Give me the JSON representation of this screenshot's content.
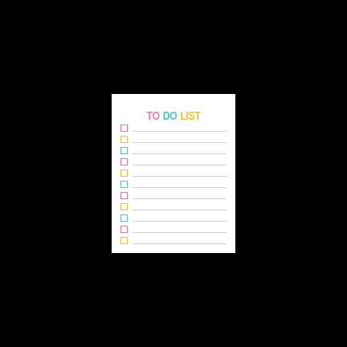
{
  "title": {
    "words": [
      {
        "text": "TO",
        "color": "#ec7ab8"
      },
      {
        "text": "DO",
        "color": "#4ec3c9"
      },
      {
        "text": "LIST",
        "color": "#f2c22a"
      }
    ]
  },
  "checklist": {
    "items": [
      {
        "checked": false,
        "color": "#e76fb0"
      },
      {
        "checked": false,
        "color": "#f0c02a"
      },
      {
        "checked": false,
        "color": "#52c2c8"
      },
      {
        "checked": false,
        "color": "#e76fb0"
      },
      {
        "checked": false,
        "color": "#f0c02a"
      },
      {
        "checked": false,
        "color": "#52c2c8"
      },
      {
        "checked": false,
        "color": "#e76fb0"
      },
      {
        "checked": false,
        "color": "#f0c02a"
      },
      {
        "checked": false,
        "color": "#52c2c8"
      },
      {
        "checked": false,
        "color": "#e76fb0"
      },
      {
        "checked": false,
        "color": "#f0c02a"
      }
    ]
  }
}
